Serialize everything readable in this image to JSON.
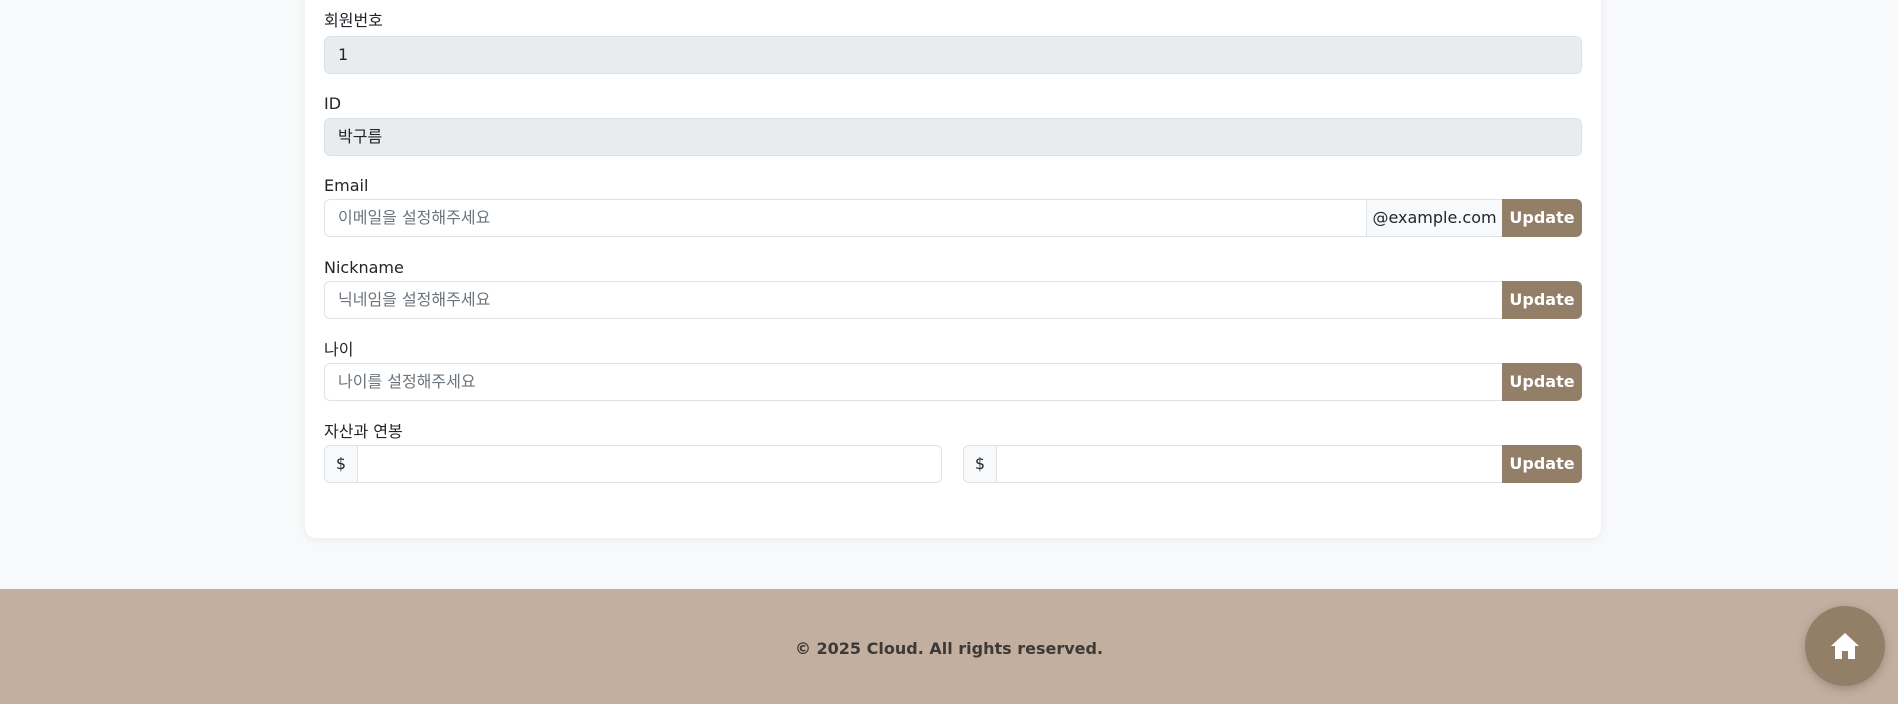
{
  "form": {
    "member_number": {
      "label": "회원번호",
      "value": "1"
    },
    "id": {
      "label": "ID",
      "value": "박구름"
    },
    "email": {
      "label": "Email",
      "placeholder": "이메일을 설정해주세요",
      "domain": "@example.com",
      "button": "Update"
    },
    "nickname": {
      "label": "Nickname",
      "placeholder": "닉네임을 설정해주세요",
      "button": "Update"
    },
    "age": {
      "label": "나이",
      "placeholder": "나이를 설정해주세요",
      "button": "Update"
    },
    "assets_salary": {
      "label": "자산과 연봉",
      "asset_currency": "$",
      "asset_value": "",
      "salary_currency": "$",
      "salary_value": "",
      "button": "Update"
    }
  },
  "footer": {
    "copyright": "© 2025 Cloud. All rights reserved."
  },
  "home_button": {
    "icon": "home-icon"
  },
  "colors": {
    "accent": "#937e68",
    "footer_bg": "#c2af9f",
    "readonly_bg": "#e9ecef"
  }
}
